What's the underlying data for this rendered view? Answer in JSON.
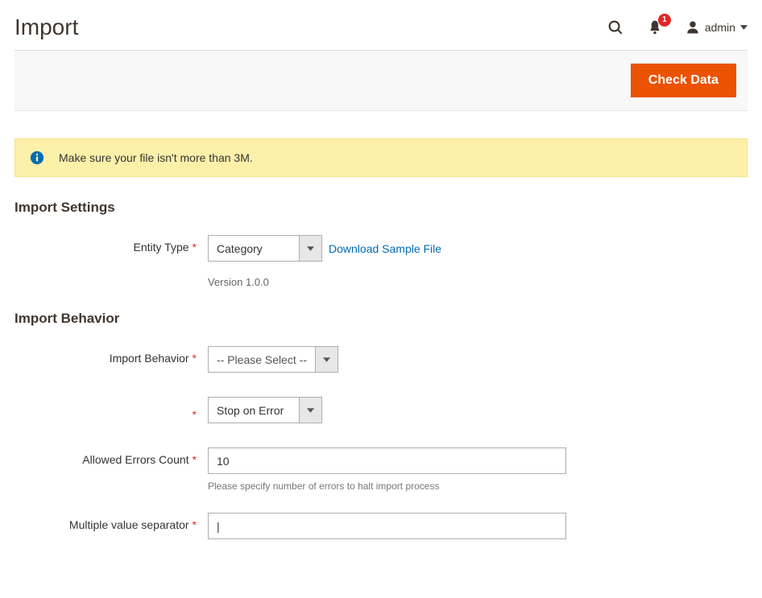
{
  "header": {
    "title": "Import",
    "notification_count": "1",
    "user_label": "admin"
  },
  "actions": {
    "check_data": "Check Data"
  },
  "notice": {
    "message": "Make sure your file isn't more than 3M."
  },
  "sections": {
    "import_settings": {
      "title": "Import Settings",
      "entity_type": {
        "label": "Entity Type",
        "value": "Category",
        "download_link": "Download Sample File",
        "version": "Version 1.0.0"
      }
    },
    "import_behavior": {
      "title": "Import Behavior",
      "behavior": {
        "label": "Import Behavior",
        "value": "-- Please Select --"
      },
      "on_error": {
        "value": "Stop on Error"
      },
      "allowed_errors": {
        "label": "Allowed Errors Count",
        "value": "10",
        "note": "Please specify number of errors to halt import process"
      },
      "multi_separator": {
        "label": "Multiple value separator",
        "value": "|"
      }
    }
  }
}
